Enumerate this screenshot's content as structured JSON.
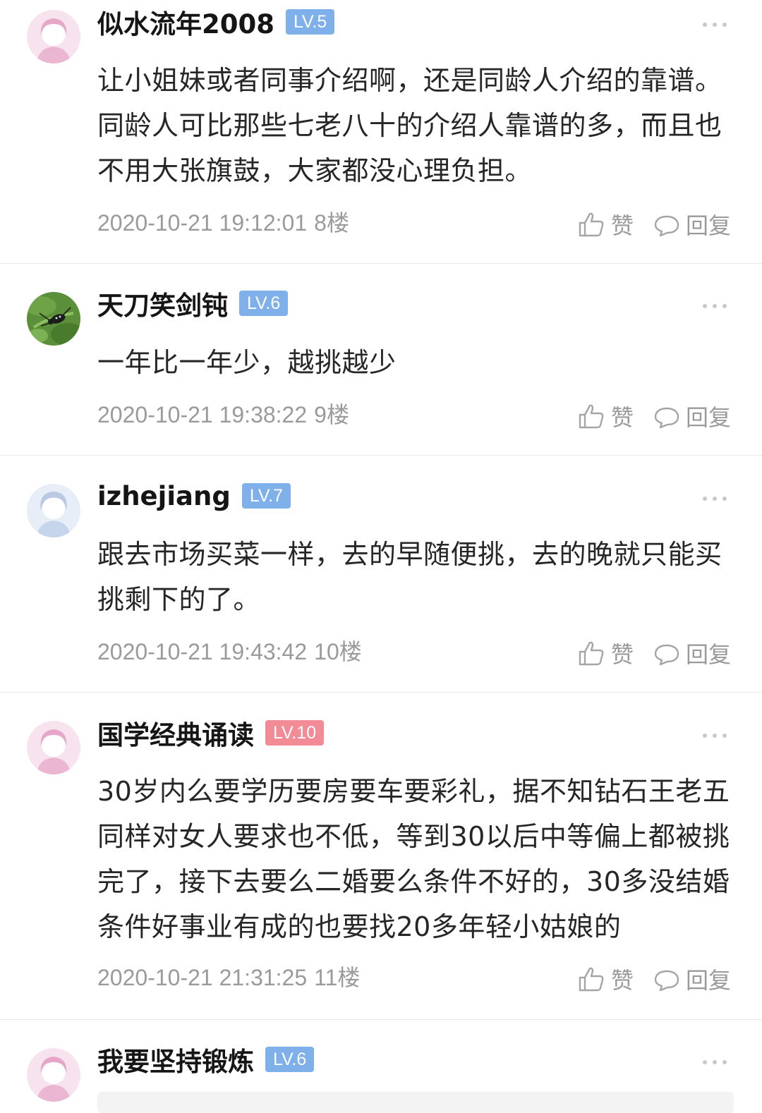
{
  "colors": {
    "level_blue": "#7fb0ea",
    "level_red": "#f28b96",
    "meta_gray": "#9a9a9a",
    "divider": "#e9e9e9"
  },
  "comments": [
    {
      "username": "似水流年2008",
      "level": "LV.5",
      "level_color": "blue",
      "avatar": "female-avatar-pink",
      "text": "让小姐妹或者同事介绍啊，还是同龄人介绍的靠谱。同龄人可比那些七老八十的介绍人靠谱的多，而且也不用大张旗鼓，大家都没心理负担。",
      "timestamp": "2020-10-21 19:12:01",
      "floor": "8楼",
      "like_label": "赞",
      "reply_label": "回复"
    },
    {
      "username": "天刀笑剑钝",
      "level": "LV.6",
      "level_color": "blue",
      "avatar": "beetle-photo-avatar",
      "text": "一年比一年少，越挑越少",
      "timestamp": "2020-10-21 19:38:22",
      "floor": "9楼",
      "like_label": "赞",
      "reply_label": "回复"
    },
    {
      "username": "izhejiang",
      "level": "LV.7",
      "level_color": "blue",
      "avatar": "female-avatar-blue",
      "text": "跟去市场买菜一样，去的早随便挑，去的晚就只能买挑剩下的了。",
      "timestamp": "2020-10-21 19:43:42",
      "floor": "10楼",
      "like_label": "赞",
      "reply_label": "回复"
    },
    {
      "username": "国学经典诵读",
      "level": "LV.10",
      "level_color": "red",
      "avatar": "female-avatar-pink",
      "text": "30岁内么要学历要房要车要彩礼，据不知钻石王老五同样对女人要求也不低，等到30以后中等偏上都被挑完了，接下去要么二婚要么条件不好的，30多没结婚条件好事业有成的也要找20多年轻小姑娘的",
      "timestamp": "2020-10-21 21:31:25",
      "floor": "11楼",
      "like_label": "赞",
      "reply_label": "回复"
    },
    {
      "username": "我要坚持锻炼",
      "level": "LV.6",
      "level_color": "blue",
      "avatar": "female-avatar-pink"
    }
  ]
}
